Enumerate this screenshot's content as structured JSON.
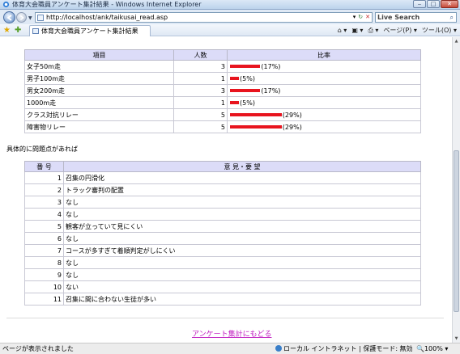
{
  "window": {
    "title": "体育大会職員アンケート集計結果 - Windows Internet Explorer",
    "buttons": {
      "minimize": "‒",
      "maximize": "□",
      "close": "✕"
    }
  },
  "address_bar": {
    "url": "http://localhost/ank/taikusai_read.asp",
    "search_placeholder": "Live Search",
    "refresh_icon": "refresh-icon",
    "stop_icon": "stop-icon"
  },
  "tab": {
    "label": "体育大会職員アンケート集計結果"
  },
  "command_bar": {
    "home": "⌂ ▾",
    "feeds": "▣ ▾",
    "print": "⎙ ▾",
    "page_menu": "ページ(P) ▾",
    "tools_menu": "ツール(O) ▾"
  },
  "results_table": {
    "headers": {
      "item": "項目",
      "count": "人数",
      "ratio": "比率"
    },
    "rows": [
      {
        "item": "女子50m走",
        "count": "3",
        "pct": 17,
        "pct_label": "(17%)"
      },
      {
        "item": "男子100m走",
        "count": "1",
        "pct": 5,
        "pct_label": "(5%)"
      },
      {
        "item": "男女200m走",
        "count": "3",
        "pct": 17,
        "pct_label": "(17%)"
      },
      {
        "item": "1000m走",
        "count": "1",
        "pct": 5,
        "pct_label": "(5%)"
      },
      {
        "item": "クラス対抗リレー",
        "count": "5",
        "pct": 29,
        "pct_label": "(29%)"
      },
      {
        "item": "障害物リレー",
        "count": "5",
        "pct": 29,
        "pct_label": "(29%)"
      }
    ],
    "bar_color": "#e8141e",
    "header_bg": "#dcdcf8"
  },
  "issues_label": "具体的に問題点があれば",
  "comments_table": {
    "headers": {
      "number": "番 号",
      "opinion": "意 見・要 望"
    },
    "rows": [
      {
        "no": "1",
        "text": "召集の円滑化"
      },
      {
        "no": "2",
        "text": "トラック審判の配置"
      },
      {
        "no": "3",
        "text": "なし"
      },
      {
        "no": "4",
        "text": "なし"
      },
      {
        "no": "5",
        "text": "観客が立っていて見にくい"
      },
      {
        "no": "6",
        "text": "なし"
      },
      {
        "no": "7",
        "text": "コースが多すぎて着順判定がしにくい"
      },
      {
        "no": "8",
        "text": "なし"
      },
      {
        "no": "9",
        "text": "なし"
      },
      {
        "no": "10",
        "text": "ない"
      },
      {
        "no": "11",
        "text": "召集に間に合わない生徒が多い"
      }
    ]
  },
  "back_link": "アンケート集計にもどる",
  "status_bar": {
    "left": "ページが表示されました",
    "zone": "ローカル イントラネット | 保護モード: 無効",
    "zoom": "100%  ▾"
  }
}
